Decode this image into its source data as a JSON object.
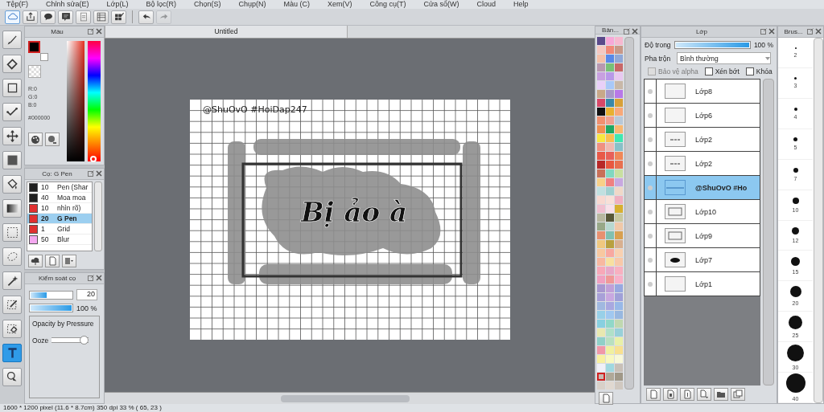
{
  "menu": [
    "Tệp(F)",
    "Chỉnh sửa(E)",
    "Lớp(L)",
    "Bộ lọc(R)",
    "Chọn(S)",
    "Chụp(N)",
    "Màu (C)",
    "Xem(V)",
    "Công cụ(T)",
    "Cửa sổ(W)",
    "Cloud",
    "Help"
  ],
  "toolbar": [
    {
      "kind": "cloud",
      "selected": true,
      "disabled": false
    },
    {
      "kind": "share",
      "selected": false,
      "disabled": false
    },
    {
      "kind": "bubble",
      "selected": false,
      "disabled": false
    },
    {
      "kind": "comment",
      "selected": false,
      "disabled": false
    },
    {
      "kind": "page",
      "selected": false,
      "disabled": false
    },
    {
      "kind": "list",
      "selected": false,
      "disabled": false
    },
    {
      "kind": "grid",
      "selected": false,
      "disabled": false
    },
    {
      "kind": "undo",
      "selected": false,
      "disabled": false
    },
    {
      "kind": "redo",
      "selected": false,
      "disabled": true
    }
  ],
  "tools": [
    {
      "kind": "brush",
      "selected": false
    },
    {
      "kind": "eraser",
      "selected": false
    },
    {
      "kind": "shape",
      "selected": false
    },
    {
      "kind": "dotpen",
      "selected": false
    },
    {
      "kind": "move",
      "selected": false
    },
    {
      "kind": "fill",
      "selected": false
    },
    {
      "kind": "bucket",
      "selected": false
    },
    {
      "kind": "gradient",
      "selected": false
    },
    {
      "kind": "select",
      "selected": false
    },
    {
      "kind": "lasso",
      "selected": false
    },
    {
      "kind": "wand",
      "selected": false
    },
    {
      "kind": "selpen",
      "selected": false
    },
    {
      "kind": "selerase",
      "selected": false
    },
    {
      "kind": "text",
      "selected": true
    },
    {
      "kind": "operation",
      "selected": false
    }
  ],
  "color_panel": {
    "title": "Màu",
    "r": "R:0",
    "g": "G:0",
    "b": "B:0",
    "hex": "#000000",
    "color": "#000000",
    "hue_slider": {
      "level": 0
    }
  },
  "brush_panel": {
    "title": "Cọ: G Pen",
    "items": [
      {
        "size": "10",
        "name": "Pen (Shar",
        "color": "#202020",
        "selected": false
      },
      {
        "size": "40",
        "name": "Moa moa",
        "color": "#202020",
        "selected": false
      },
      {
        "size": "10",
        "name": "nhìn rõ)",
        "color": "#e03030",
        "selected": false
      },
      {
        "size": "20",
        "name": "G Pen",
        "color": "#e03030",
        "selected": true
      },
      {
        "size": "1",
        "name": "Grid",
        "color": "#e03030",
        "selected": false
      },
      {
        "size": "50",
        "name": "Blur",
        "color": "#f4a8f0",
        "selected": false
      }
    ]
  },
  "brush_control": {
    "title": "Kiểm soát cọ",
    "size_slider": {
      "level": 0.4
    },
    "size": "20",
    "opacity_slider": {
      "level": 1
    },
    "opacity": "100 %",
    "option": "Opacity by Pressure",
    "ooze_label": "Ooze",
    "ooze_slider": {
      "level": 1
    }
  },
  "document": {
    "tab": "Untitled",
    "watermark": "@ShuOvO #HoiDap247",
    "art_text": "Bị ảo à"
  },
  "palette": {
    "title": "Bản...",
    "swatches": [
      {
        "color": "#5a4a8a",
        "selected": false
      },
      {
        "color": "#f7a8d8",
        "selected": false
      },
      {
        "color": "#f7b8d0",
        "selected": false
      },
      {
        "color": "#f5c8c0",
        "selected": false
      },
      {
        "color": "#f08878",
        "selected": false
      },
      {
        "color": "#c89888",
        "selected": false
      },
      {
        "color": "#f5c0a8",
        "selected": false
      },
      {
        "color": "#5888e8",
        "selected": false
      },
      {
        "color": "#90a8d8",
        "selected": false
      },
      {
        "color": "#b898b0",
        "selected": false
      },
      {
        "color": "#78c078",
        "selected": false
      },
      {
        "color": "#c86868",
        "selected": false
      },
      {
        "color": "#c8a0e0",
        "selected": false
      },
      {
        "color": "#b898e8",
        "selected": false
      },
      {
        "color": "#e8c8f0",
        "selected": false
      },
      {
        "color": "#e8d0f8",
        "selected": false
      },
      {
        "color": "#a8c8f8",
        "selected": false
      },
      {
        "color": "#c8b8a8",
        "selected": false
      },
      {
        "color": "#c8a888",
        "selected": false
      },
      {
        "color": "#a898c8",
        "selected": false
      },
      {
        "color": "#b878e8",
        "selected": false
      },
      {
        "color": "#d84868",
        "selected": false
      },
      {
        "color": "#3888a8",
        "selected": false
      },
      {
        "color": "#d8a038",
        "selected": false
      },
      {
        "color": "#101010",
        "selected": false
      },
      {
        "color": "#e8b030",
        "selected": false
      },
      {
        "color": "#f8a878",
        "selected": false
      },
      {
        "color": "#f09070",
        "selected": false
      },
      {
        "color": "#f0a090",
        "selected": false
      },
      {
        "color": "#b8c8d8",
        "selected": false
      },
      {
        "color": "#f09050",
        "selected": false
      },
      {
        "color": "#20a860",
        "selected": false
      },
      {
        "color": "#f8b870",
        "selected": false
      },
      {
        "color": "#f8e840",
        "selected": false
      },
      {
        "color": "#f8c050",
        "selected": false
      },
      {
        "color": "#40e8b0",
        "selected": false
      },
      {
        "color": "#f09080",
        "selected": false
      },
      {
        "color": "#f0b8b0",
        "selected": false
      },
      {
        "color": "#88c0c8",
        "selected": false
      },
      {
        "color": "#e85848",
        "selected": false
      },
      {
        "color": "#e86058",
        "selected": false
      },
      {
        "color": "#f08858",
        "selected": false
      },
      {
        "color": "#b82828",
        "selected": false
      },
      {
        "color": "#e85840",
        "selected": false
      },
      {
        "color": "#e87050",
        "selected": false
      },
      {
        "color": "#c87058",
        "selected": false
      },
      {
        "color": "#80d8c0",
        "selected": false
      },
      {
        "color": "#c8e0a0",
        "selected": false
      },
      {
        "color": "#f8d088",
        "selected": false
      },
      {
        "color": "#f08080",
        "selected": false
      },
      {
        "color": "#c8a8e0",
        "selected": false
      },
      {
        "color": "#c0e0e0",
        "selected": false
      },
      {
        "color": "#a0d0d0",
        "selected": false
      },
      {
        "color": "#f0d8c8",
        "selected": false
      },
      {
        "color": "#f8d8d0",
        "selected": false
      },
      {
        "color": "#f8e0d8",
        "selected": false
      },
      {
        "color": "#f0b0c0",
        "selected": false
      },
      {
        "color": "#f0c0d0",
        "selected": false
      },
      {
        "color": "#f8e0e8",
        "selected": false
      },
      {
        "color": "#d8b030",
        "selected": false
      },
      {
        "color": "#b8b8a0",
        "selected": false
      },
      {
        "color": "#585838",
        "selected": false
      },
      {
        "color": "#c8c8a0",
        "selected": false
      },
      {
        "color": "#98a888",
        "selected": false
      },
      {
        "color": "#b8d8d0",
        "selected": false
      },
      {
        "color": "#f0c8a8",
        "selected": false
      },
      {
        "color": "#e89070",
        "selected": false
      },
      {
        "color": "#80c0b0",
        "selected": false
      },
      {
        "color": "#d8a050",
        "selected": false
      },
      {
        "color": "#f0c880",
        "selected": false
      },
      {
        "color": "#b8a040",
        "selected": false
      },
      {
        "color": "#d8b090",
        "selected": false
      },
      {
        "color": "#f8c8a0",
        "selected": false
      },
      {
        "color": "#f8a8a0",
        "selected": false
      },
      {
        "color": "#f8d0b0",
        "selected": false
      },
      {
        "color": "#f8b8a0",
        "selected": false
      },
      {
        "color": "#f8e0a0",
        "selected": false
      },
      {
        "color": "#f8c8a8",
        "selected": false
      },
      {
        "color": "#f8a8b8",
        "selected": false
      },
      {
        "color": "#e8a8c8",
        "selected": false
      },
      {
        "color": "#f8b0c0",
        "selected": false
      },
      {
        "color": "#f0a0c0",
        "selected": false
      },
      {
        "color": "#f09898",
        "selected": false
      },
      {
        "color": "#f8b0c8",
        "selected": false
      },
      {
        "color": "#a898d0",
        "selected": false
      },
      {
        "color": "#c0a0d8",
        "selected": false
      },
      {
        "color": "#98a8e0",
        "selected": false
      },
      {
        "color": "#a8a0d8",
        "selected": false
      },
      {
        "color": "#c8a8e0",
        "selected": false
      },
      {
        "color": "#a0a0d8",
        "selected": false
      },
      {
        "color": "#a0b8e0",
        "selected": false
      },
      {
        "color": "#a8a8e0",
        "selected": false
      },
      {
        "color": "#98b8e8",
        "selected": false
      },
      {
        "color": "#98d0e8",
        "selected": false
      },
      {
        "color": "#a0c8f0",
        "selected": false
      },
      {
        "color": "#98b8e0",
        "selected": false
      },
      {
        "color": "#88d0e0",
        "selected": false
      },
      {
        "color": "#90d8c8",
        "selected": false
      },
      {
        "color": "#c0d8b0",
        "selected": false
      },
      {
        "color": "#e8e8b0",
        "selected": false
      },
      {
        "color": "#b0e0c8",
        "selected": false
      },
      {
        "color": "#98d0d8",
        "selected": false
      },
      {
        "color": "#90d0c8",
        "selected": false
      },
      {
        "color": "#b8e0c0",
        "selected": false
      },
      {
        "color": "#e8f0a8",
        "selected": false
      },
      {
        "color": "#f098a8",
        "selected": false
      },
      {
        "color": "#f0f0a0",
        "selected": false
      },
      {
        "color": "#f8e090",
        "selected": false
      },
      {
        "color": "#f8f0a0",
        "selected": false
      },
      {
        "color": "#f8f8c0",
        "selected": false
      },
      {
        "color": "#f8f8d8",
        "selected": false
      },
      {
        "color": "#f0f0f8",
        "selected": false
      },
      {
        "color": "#a0d8e0",
        "selected": false
      },
      {
        "color": "#c8c0b8",
        "selected": false
      },
      {
        "color": "#c8b8b0",
        "selected": true
      },
      {
        "color": "#b0a898",
        "selected": false
      },
      {
        "color": "#a09888",
        "selected": false
      },
      {
        "color": "#d8d0c8",
        "selected": false
      },
      {
        "color": "#e0d8d0",
        "selected": false
      },
      {
        "color": "#d0c8c0",
        "selected": false
      }
    ]
  },
  "layers": {
    "title": "Lớp",
    "opacity_label": "Độ trong",
    "opacity_slider": {
      "level": 1
    },
    "opacity": "100 %",
    "blend_label": "Pha trộn",
    "blend": "Bình thường",
    "options": [
      {
        "label": "Bảo vệ alpha",
        "checked": false,
        "disabled": true
      },
      {
        "label": "Xén bớt",
        "checked": false,
        "disabled": false
      },
      {
        "label": "Khóa",
        "checked": false,
        "disabled": false
      }
    ],
    "items": [
      {
        "name": "Lớp8",
        "kind": "empty",
        "selected": false
      },
      {
        "name": "Lớp6",
        "kind": "empty",
        "selected": false
      },
      {
        "name": "Lớp2",
        "kind": "dashes",
        "selected": false
      },
      {
        "name": "Lớp2",
        "kind": "dashes",
        "selected": false
      },
      {
        "name": "@ShuOvO #Ho",
        "kind": "text",
        "selected": true
      },
      {
        "name": "Lớp10",
        "kind": "frame",
        "selected": false
      },
      {
        "name": "Lớp9",
        "kind": "frame",
        "selected": false
      },
      {
        "name": "Lớp7",
        "kind": "blob",
        "selected": false
      },
      {
        "name": "Lớp1",
        "kind": "empty",
        "selected": false
      }
    ]
  },
  "brush_sizes": {
    "title": "Brus...",
    "sizes": [
      "2",
      "3",
      "4",
      "5",
      "7",
      "10",
      "12",
      "15",
      "20",
      "25",
      "30",
      "40"
    ]
  },
  "status_bar": "1600 * 1200 pixel  (11.6 * 8.7cm)  350 dpi  33 %  ( 65, 23 )"
}
